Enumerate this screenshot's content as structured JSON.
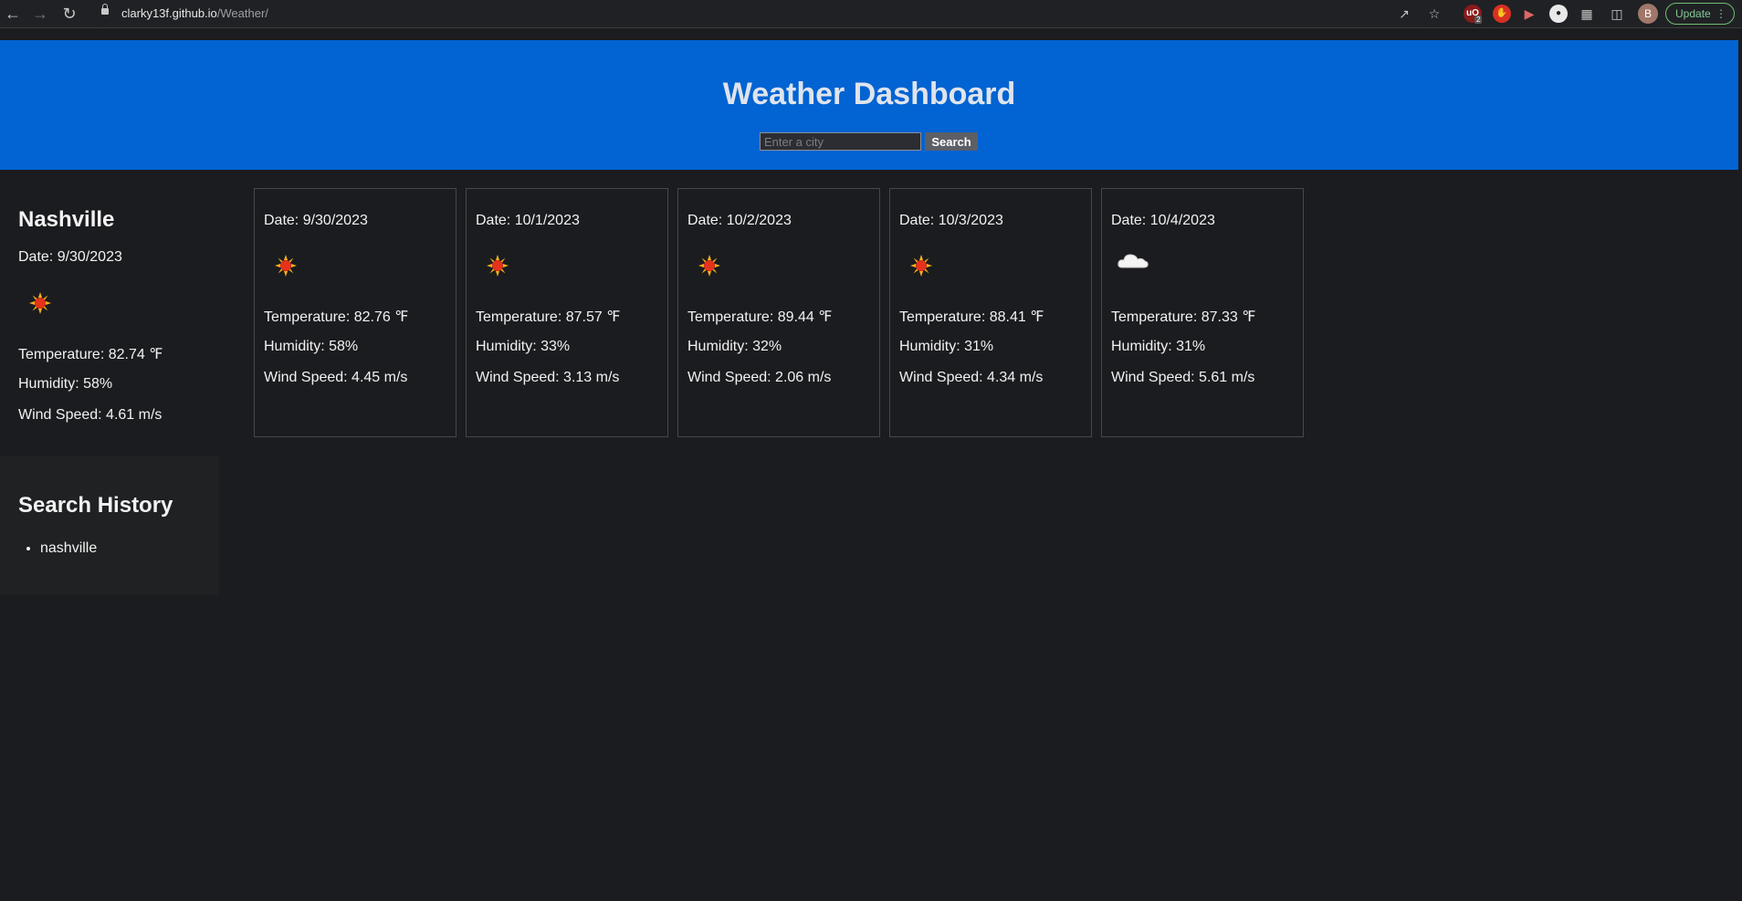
{
  "browser": {
    "url_host": "clarky13f.github.io",
    "url_path": "/Weather/",
    "ext_badge": "2",
    "avatar_letter": "B",
    "update_label": "Update"
  },
  "header": {
    "title": "Weather Dashboard",
    "search_placeholder": "Enter a city",
    "search_button": "Search"
  },
  "current": {
    "city": "Nashville",
    "date": "Date: 9/30/2023",
    "icon": "sun-icon",
    "temperature": "Temperature: 82.74 ℉",
    "humidity": "Humidity: 58%",
    "wind": "Wind Speed: 4.61 m/s"
  },
  "history": {
    "title": "Search History",
    "items": [
      "nashville"
    ]
  },
  "forecast": [
    {
      "date": "Date: 9/30/2023",
      "icon": "sun-icon",
      "temperature": "Temperature: 82.76 ℉",
      "humidity": "Humidity: 58%",
      "wind": "Wind Speed: 4.45 m/s"
    },
    {
      "date": "Date: 10/1/2023",
      "icon": "sun-icon",
      "temperature": "Temperature: 87.57 ℉",
      "humidity": "Humidity: 33%",
      "wind": "Wind Speed: 3.13 m/s"
    },
    {
      "date": "Date: 10/2/2023",
      "icon": "sun-icon",
      "temperature": "Temperature: 89.44 ℉",
      "humidity": "Humidity: 32%",
      "wind": "Wind Speed: 2.06 m/s"
    },
    {
      "date": "Date: 10/3/2023",
      "icon": "sun-icon",
      "temperature": "Temperature: 88.41 ℉",
      "humidity": "Humidity: 31%",
      "wind": "Wind Speed: 4.34 m/s"
    },
    {
      "date": "Date: 10/4/2023",
      "icon": "cloud-icon",
      "temperature": "Temperature: 87.33 ℉",
      "humidity": "Humidity: 31%",
      "wind": "Wind Speed: 5.61 m/s"
    }
  ],
  "colors": {
    "header_bg": "#0263d2",
    "page_bg": "#1b1c1f"
  }
}
